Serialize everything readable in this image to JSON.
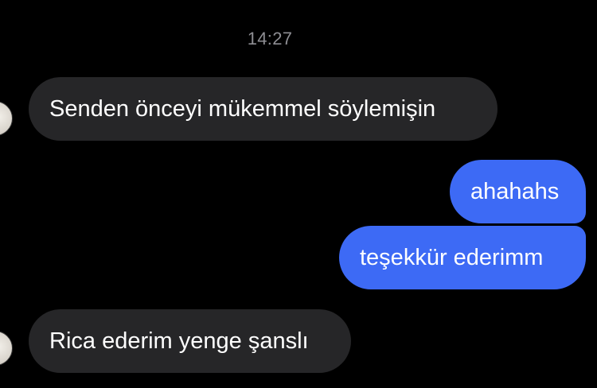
{
  "chat": {
    "timestamp": "14:27",
    "messages": [
      {
        "direction": "incoming",
        "text": "Senden önceyi mükemmel söylemişin"
      },
      {
        "direction": "outgoing",
        "text": "ahahahs"
      },
      {
        "direction": "outgoing",
        "text": "teşekkür ederimm"
      },
      {
        "direction": "incoming",
        "text": "Rica ederim yenge şanslı"
      }
    ]
  },
  "colors": {
    "background": "#000000",
    "incoming_bubble": "#262628",
    "outgoing_bubble": "#3d6af5",
    "timestamp_text": "#8e8e93"
  }
}
